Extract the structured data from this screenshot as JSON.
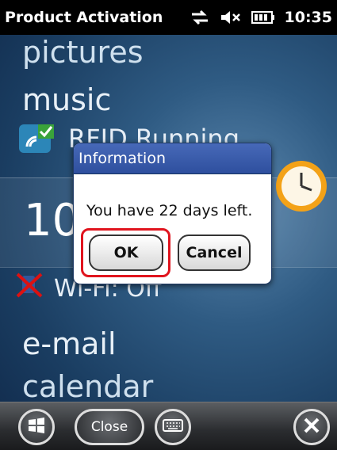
{
  "status_bar": {
    "app_title": "Product Activation",
    "time": "10:35"
  },
  "background": {
    "items": [
      "pictures",
      "music",
      "RFID Running",
      "10",
      "Wi-Fi: Off",
      "e-mail",
      "calendar"
    ]
  },
  "dialog": {
    "title": "Information",
    "message": "You have 22 days left.",
    "ok_label": "OK",
    "cancel_label": "Cancel"
  },
  "taskbar": {
    "close_label": "Close"
  },
  "colors": {
    "highlight": "#e0141e",
    "dialog_title_bg": "#3a5aab"
  }
}
